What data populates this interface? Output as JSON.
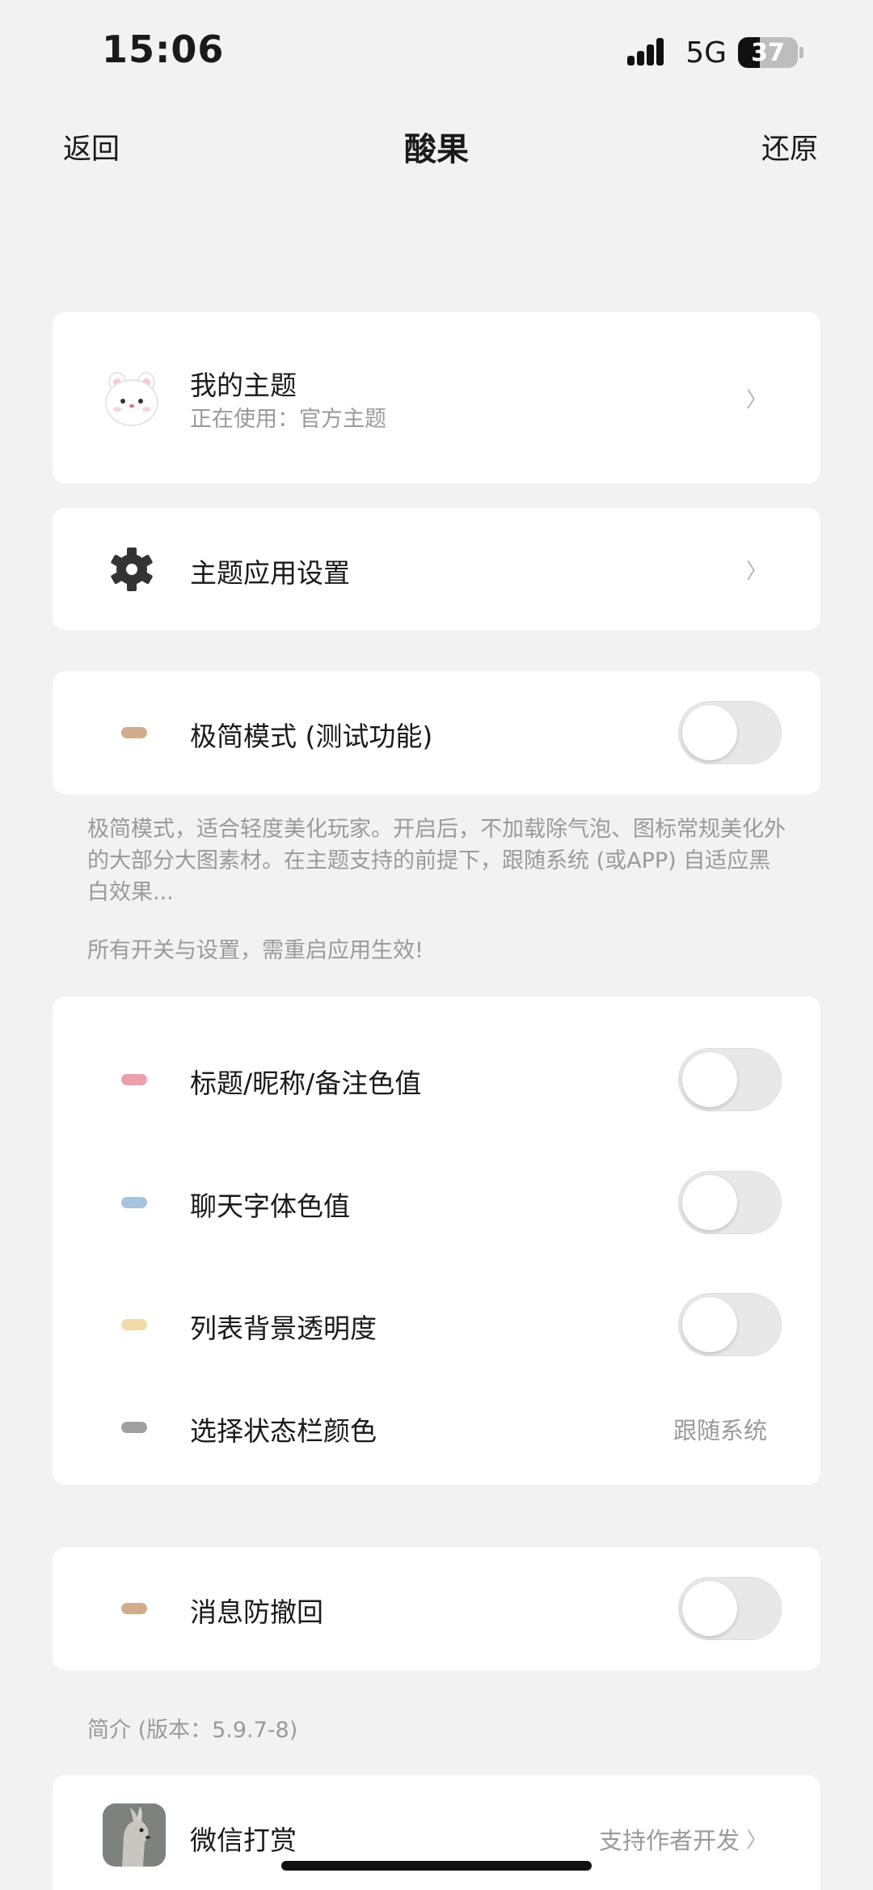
{
  "status_bar": {
    "time": "15:06",
    "network": "5G",
    "battery": "37",
    "battery_level_pct": 37
  },
  "nav": {
    "back": "返回",
    "title": "酸果",
    "reset": "还原"
  },
  "theme_card": {
    "title": "我的主题",
    "subtitle": "正在使用：官方主题",
    "icon": "bear-avatar-icon"
  },
  "theme_settings": {
    "label": "主题应用设置",
    "icon": "gear-icon"
  },
  "minimal_mode": {
    "label": "极简模式 (测试功能)",
    "pill_color": "#d2ab8b",
    "enabled": false
  },
  "minimal_note": "极简模式，适合轻度美化玩家。开启后，不加载除气泡、图标常规美化外的大部分大图素材。在主题支持的前提下，跟随系统 (或APP) 自适应黑白效果...",
  "restart_note": "所有开关与设置，需重启应用生效!",
  "color_settings": [
    {
      "label": "标题/昵称/备注色值",
      "pill_color": "#eba0ab",
      "enabled": false
    },
    {
      "label": "聊天字体色值",
      "pill_color": "#a7c3de",
      "enabled": false
    },
    {
      "label": "列表背景透明度",
      "pill_color": "#f0dba9",
      "enabled": false
    },
    {
      "label": "选择状态栏颜色",
      "pill_color": "#a0a0a0",
      "value": "跟随系统"
    }
  ],
  "anti_recall": {
    "label": "消息防撤回",
    "pill_color": "#d2ab8b",
    "enabled": false
  },
  "intro_note": "简介 (版本：5.9.7-8)",
  "reward": {
    "label": "微信打赏",
    "value": "支持作者开发",
    "icon": "kangaroo-avatar-icon"
  },
  "chevron": "〉"
}
